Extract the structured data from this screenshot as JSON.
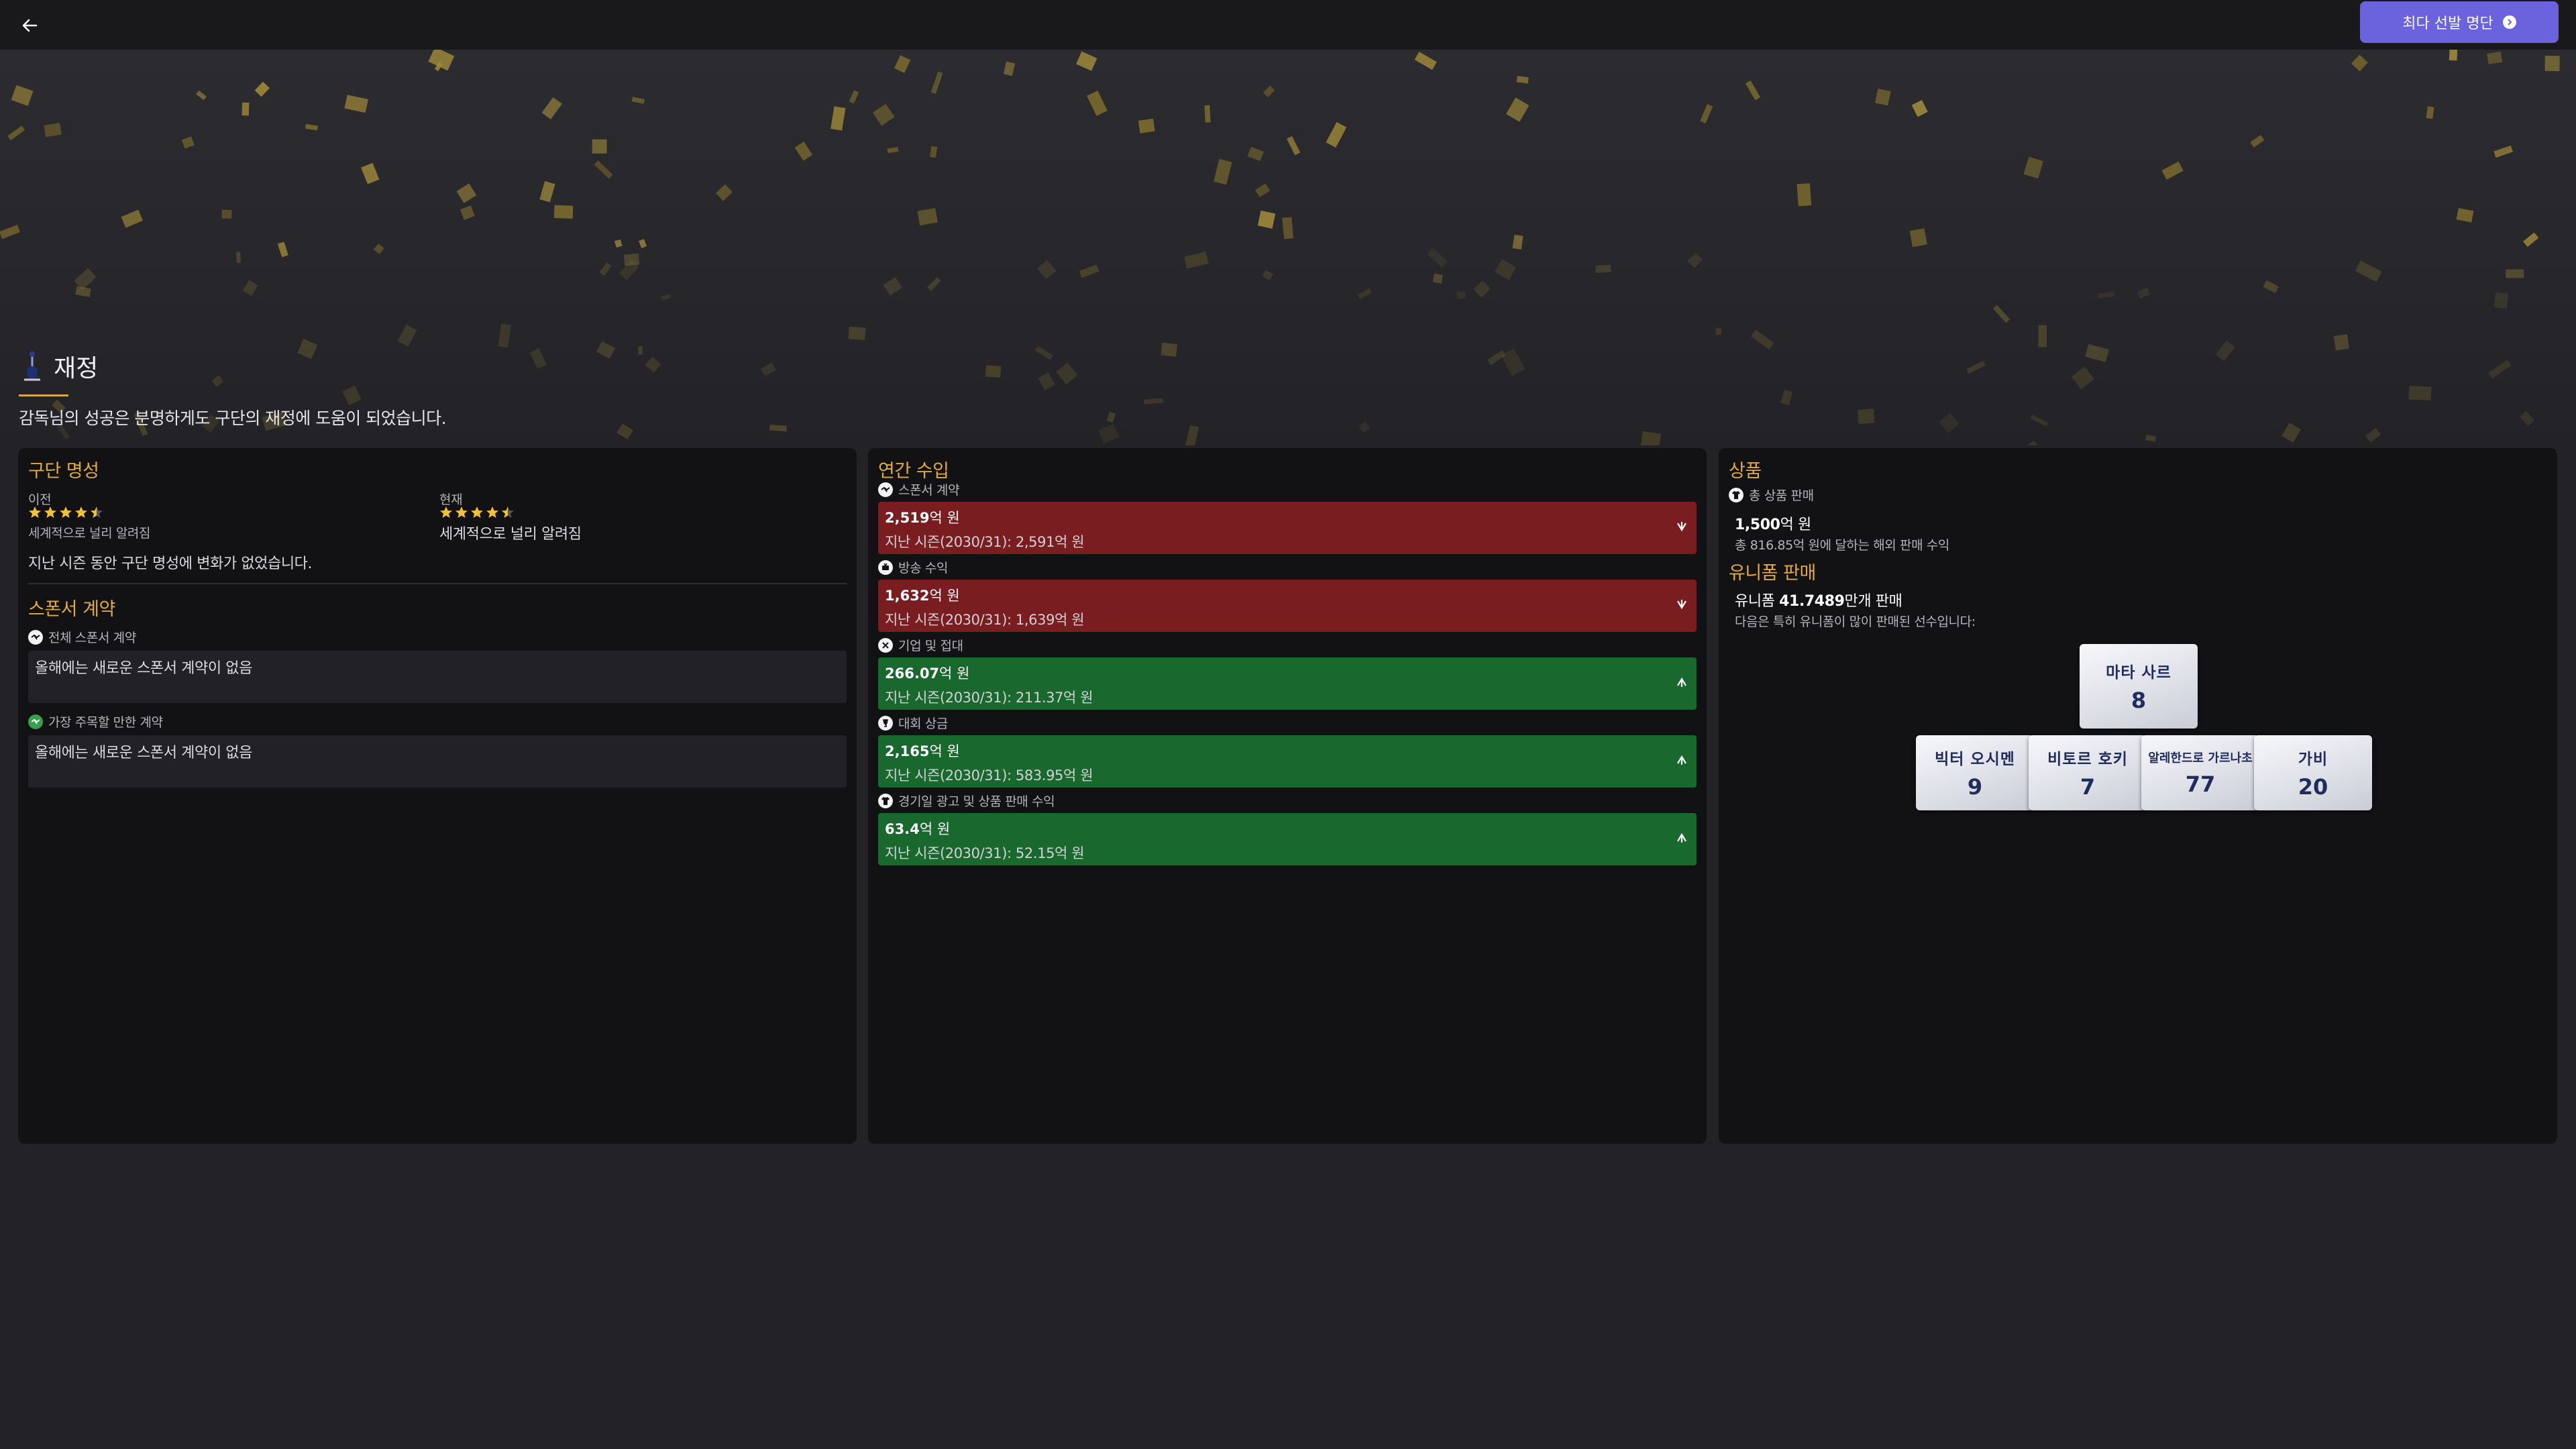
{
  "topbar": {
    "primary_button_label": "최다 선발 명단"
  },
  "section": {
    "title": "재정",
    "description": "감독님의 성공은 분명하게도 구단의 재정에 도움이 되었습니다."
  },
  "reputation": {
    "title": "구단 명성",
    "previous": {
      "label": "이전",
      "stars": 4.5,
      "text": "세계적으로 널리 알려짐"
    },
    "current": {
      "label": "현재",
      "stars": 4.5,
      "text": "세계적으로 널리 알려짐"
    },
    "note": "지난 시즌 동안 구단 명성에 변화가 없었습니다."
  },
  "sponsors": {
    "title": "스폰서 계약",
    "all": {
      "label": "전체 스폰서 계약",
      "value": "올해에는 새로운 스폰서 계약이 없음"
    },
    "notable": {
      "label": "가장 주목할 만한 계약",
      "value": "올해에는 새로운 스폰서 계약이 없음"
    }
  },
  "income": {
    "title": "연간 수입",
    "rows": [
      {
        "label": "스폰서 계약",
        "amount": "2,519",
        "unit": "억 원",
        "prev": "지난 시즌(2030/31): 2,591억 원",
        "trend": "down",
        "icon": "handshake-icon"
      },
      {
        "label": "방송 수익",
        "amount": "1,632",
        "unit": "억 원",
        "prev": "지난 시즌(2030/31): 1,639억 원",
        "trend": "down",
        "icon": "broadcast-icon"
      },
      {
        "label": "기업 및 접대",
        "amount": "266.07",
        "unit": "억 원",
        "prev": "지난 시즌(2030/31): 211.37억 원",
        "trend": "up",
        "icon": "hospitality-icon"
      },
      {
        "label": "대회 상금",
        "amount": "2,165",
        "unit": "억 원",
        "prev": "지난 시즌(2030/31): 583.95억 원",
        "trend": "up",
        "icon": "prize-money-icon"
      },
      {
        "label": "경기일 광고 및 상품 판매 수익",
        "amount": "63.4",
        "unit": "억 원",
        "prev": "지난 시즌(2030/31): 52.15억 원",
        "trend": "up",
        "icon": "matchday-icon"
      }
    ]
  },
  "merch": {
    "title": "상품",
    "total_label": "총 상품 판매",
    "total_amount": "1,500",
    "total_unit": "억 원",
    "total_note": "총 816.85억 원에 달하는 해외 판매 수익",
    "uniform_title": "유니폼 판매",
    "uniform_prefix": "유니폼 ",
    "uniform_count": "41.7489",
    "uniform_suffix": "만개 판매",
    "uniform_note": "다음은 특히 유니폼이 많이 판매된 선수입니다:",
    "players": [
      {
        "name": "마타 사르",
        "number": "8"
      },
      {
        "name": "빅터 오시멘",
        "number": "9"
      },
      {
        "name": "비토르 호키",
        "number": "7"
      },
      {
        "name": "알레한드로 가르나초",
        "number": "77"
      },
      {
        "name": "가비",
        "number": "20"
      }
    ]
  },
  "colors": {
    "accent": "#e0ab3e",
    "button": "#6b63dd",
    "down": "#791d20",
    "up": "#19692e"
  }
}
